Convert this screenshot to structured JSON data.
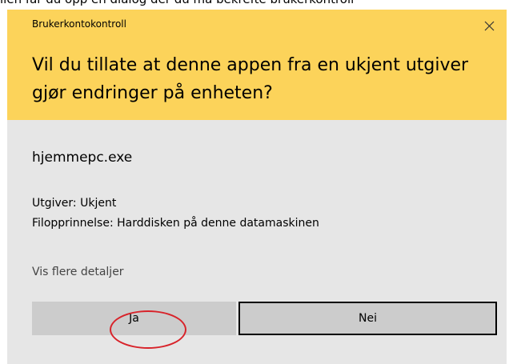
{
  "background_text": "ilen får du opp en dialog der du må bekrefte brukerkontroll",
  "dialog": {
    "title": "Brukerkontokontroll",
    "question": "Vil du tillate at denne appen fra en ukjent utgiver gjør endringer på enheten?",
    "app_name": "hjemmepc.exe",
    "publisher": "Utgiver: Ukjent",
    "file_origin": "Filopprinnelse: Harddisken på denne datamaskinen",
    "details_link": "Vis flere detaljer",
    "yes_label": "Ja",
    "no_label": "Nei",
    "close_icon": "close-icon"
  },
  "colors": {
    "header": "#fcd35a",
    "body": "#e6e6e6",
    "button": "#cccccc",
    "highlight": "#d8232a"
  }
}
